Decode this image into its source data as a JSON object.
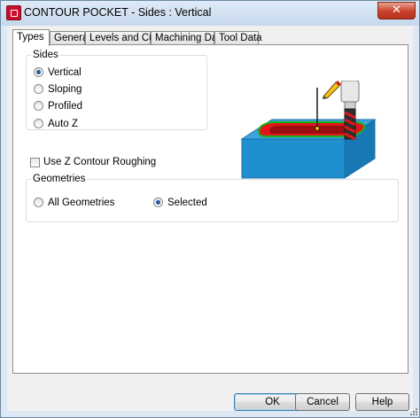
{
  "window": {
    "title": "CONTOUR POCKET - Sides : Vertical",
    "close_glyph": "✕"
  },
  "tabs": [
    {
      "label": "Types"
    },
    {
      "label": "General"
    },
    {
      "label": "Levels and Cuts"
    },
    {
      "label": "Machining Data"
    },
    {
      "label": "Tool Data"
    }
  ],
  "active_tab": "Types",
  "sides": {
    "label": "Sides",
    "options": [
      {
        "label": "Vertical",
        "checked": true
      },
      {
        "label": "Sloping",
        "checked": false
      },
      {
        "label": "Profiled",
        "checked": false
      },
      {
        "label": "Auto Z",
        "checked": false
      }
    ]
  },
  "use_z_contour": {
    "label": "Use Z Contour Roughing",
    "checked": false
  },
  "geometries": {
    "label": "Geometries",
    "options": [
      {
        "label": "All Geometries",
        "checked": false
      },
      {
        "label": "Selected",
        "checked": true
      }
    ]
  },
  "illustration": {
    "icons": [
      "pocket-block-icon",
      "end-mill-icon",
      "pencil-icon"
    ]
  },
  "buttons": {
    "ok": "OK",
    "cancel": "Cancel",
    "help": "Help"
  },
  "colors": {
    "block": "#1f8fd0",
    "pocket_wall": "#e0161b",
    "contour": "#19b31a",
    "close": "#c8412a"
  }
}
